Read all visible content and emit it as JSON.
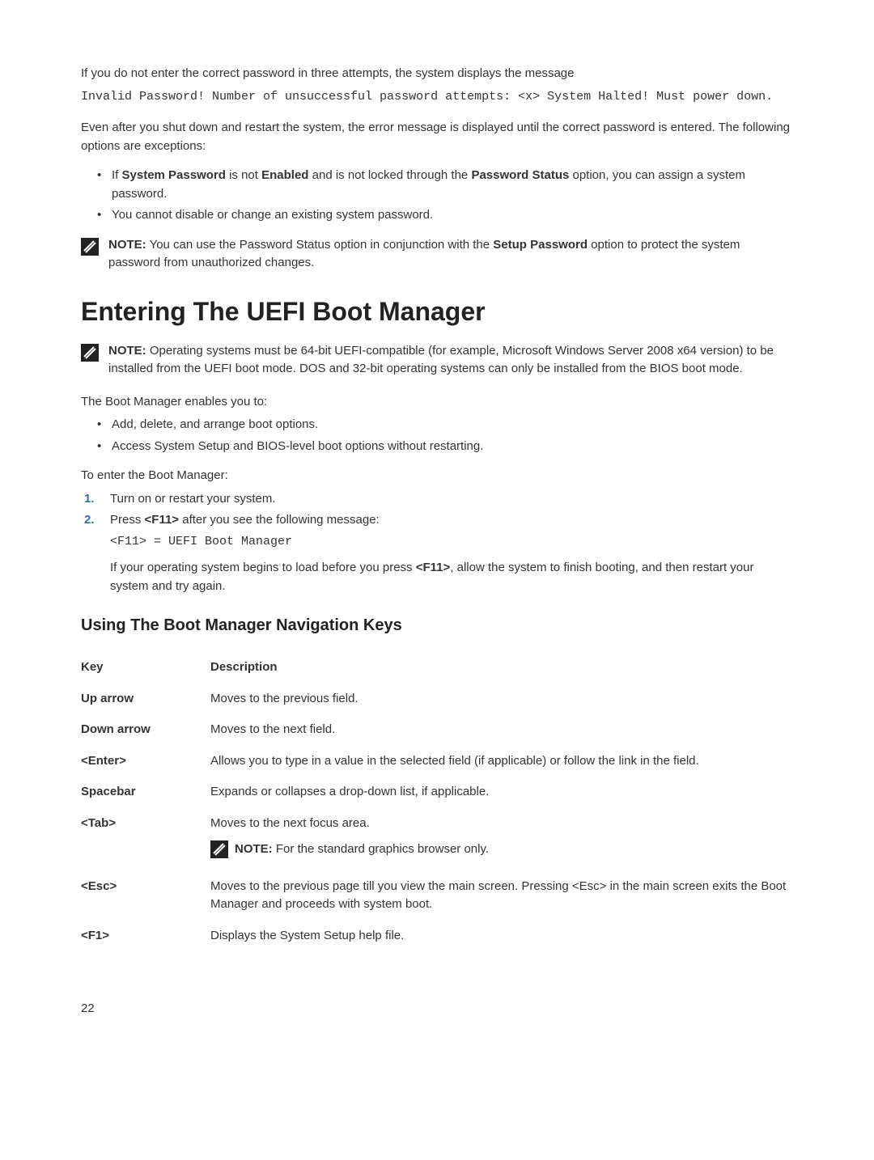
{
  "top_section": {
    "para1": "If you do not enter the correct password in three attempts, the system displays the message",
    "code1": "Invalid Password! Number of unsuccessful password attempts: <x> System Halted! Must power down.",
    "para2": "Even after you shut down and restart the system, the error message is displayed until the correct password is entered. The following options are exceptions:",
    "bullet1_prefix": "If ",
    "bullet1_bold1": "System Password",
    "bullet1_mid1": " is not ",
    "bullet1_bold2": "Enabled",
    "bullet1_mid2": " and is not locked through the ",
    "bullet1_bold3": "Password Status",
    "bullet1_suffix": " option, you can assign a system password.",
    "bullet2": "You cannot disable or change an existing system password.",
    "note_label": "NOTE:",
    "note_text1": " You can use the Password Status option in conjunction with the ",
    "note_bold": "Setup Password",
    "note_text2": " option to protect the system password from unauthorized changes."
  },
  "uefi_section": {
    "title": "Entering The UEFI Boot Manager",
    "note_label": "NOTE:",
    "note_text": " Operating systems must be 64-bit UEFI-compatible (for example, Microsoft Windows Server 2008 x64 version) to be installed from the UEFI boot mode. DOS and 32-bit operating systems can only be installed from the BIOS boot mode.",
    "para_enables": "The Boot Manager enables you to:",
    "bullet1": "Add, delete, and arrange boot options.",
    "bullet2": "Access System Setup and BIOS-level boot options without restarting.",
    "para_enter": "To enter the Boot Manager:",
    "step1_num": "1.",
    "step1": "Turn on or restart your system.",
    "step2_num": "2.",
    "step2_prefix": "Press ",
    "step2_bold": "<F11>",
    "step2_suffix": " after you see the following message:",
    "step2_code": "<F11> = UEFI Boot Manager",
    "step2_para_prefix": "If your operating system begins to load before you press ",
    "step2_para_bold": "<F11>",
    "step2_para_suffix": ", allow the system to finish booting, and then restart your system and try again."
  },
  "nav_section": {
    "title": "Using The Boot Manager Navigation Keys",
    "header_key": "Key",
    "header_desc": "Description",
    "rows": {
      "up": {
        "key": "Up arrow",
        "desc": "Moves to the previous field."
      },
      "down": {
        "key": "Down arrow",
        "desc": "Moves to the next field."
      },
      "enter": {
        "key": "<Enter>",
        "desc": "Allows you to type in a value in the selected field (if applicable) or follow the link in the field."
      },
      "space": {
        "key": "Spacebar",
        "desc": "Expands or collapses a drop-down list, if applicable."
      },
      "tab": {
        "key": "<Tab>",
        "desc": "Moves to the next focus area.",
        "note_label": "NOTE:",
        "note_text": " For the standard graphics browser only."
      },
      "esc": {
        "key": "<Esc>",
        "desc": "Moves to the previous page till you view the main screen. Pressing <Esc> in the main screen exits the Boot Manager and proceeds with system boot."
      },
      "f1": {
        "key": "<F1>",
        "desc": "Displays the System Setup help file."
      }
    }
  },
  "page_number": "22"
}
